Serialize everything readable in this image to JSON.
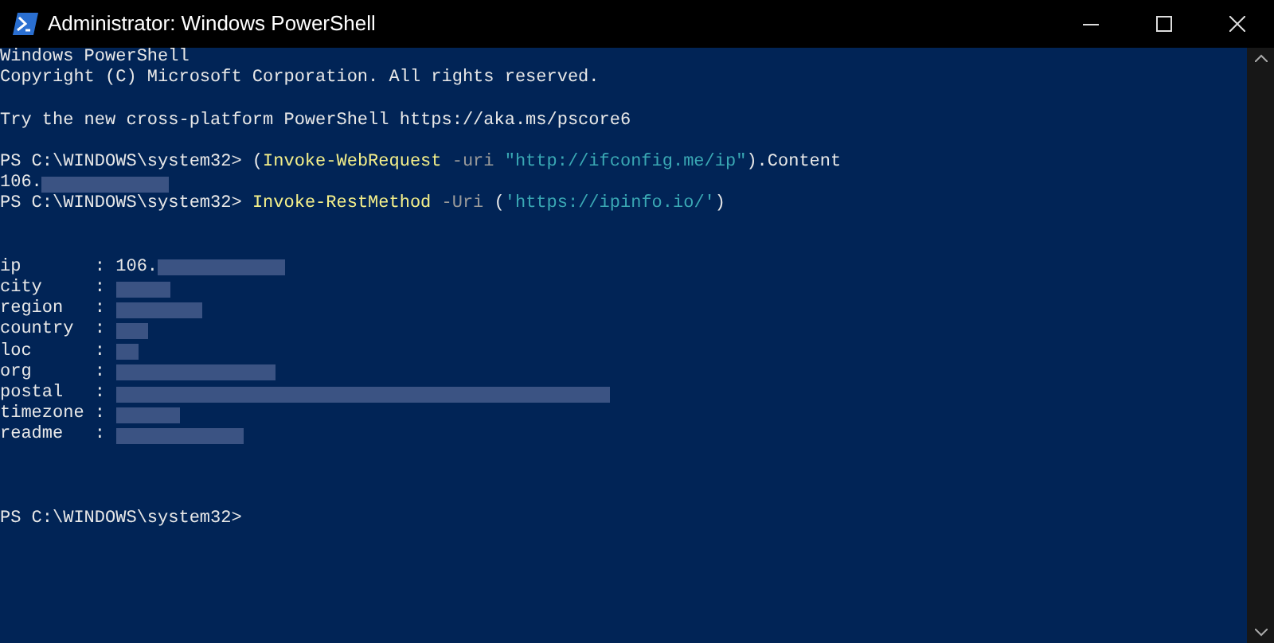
{
  "window": {
    "title": "Administrator: Windows PowerShell"
  },
  "console": {
    "lines": [
      {
        "kind": "text",
        "segments": [
          {
            "kind": "plain",
            "text": "Windows PowerShell"
          }
        ]
      },
      {
        "kind": "text",
        "segments": [
          {
            "kind": "plain",
            "text": "Copyright (C) Microsoft Corporation. All rights reserved."
          }
        ]
      },
      {
        "kind": "blank"
      },
      {
        "kind": "text",
        "segments": [
          {
            "kind": "plain",
            "text": "Try the new cross-platform PowerShell https://aka.ms/pscore6"
          }
        ]
      },
      {
        "kind": "blank"
      },
      {
        "kind": "text",
        "segments": [
          {
            "kind": "plain",
            "text": "PS C:\\WINDOWS\\system32> ("
          },
          {
            "kind": "command",
            "text": "Invoke-WebRequest"
          },
          {
            "kind": "parameter",
            "text": " -uri "
          },
          {
            "kind": "string",
            "text": "\"http://ifconfig.me/ip\""
          },
          {
            "kind": "plain",
            "text": ").Content"
          }
        ]
      },
      {
        "kind": "text",
        "segments": [
          {
            "kind": "plain",
            "text": "106."
          },
          {
            "kind": "redacted"
          }
        ]
      },
      {
        "kind": "text",
        "segments": [
          {
            "kind": "plain",
            "text": "PS C:\\WINDOWS\\system32> "
          },
          {
            "kind": "command",
            "text": "Invoke-RestMethod"
          },
          {
            "kind": "parameter",
            "text": " -Uri "
          },
          {
            "kind": "plain",
            "text": "("
          },
          {
            "kind": "string",
            "text": "'https://ipinfo.io/'"
          },
          {
            "kind": "plain",
            "text": ")"
          }
        ]
      },
      {
        "kind": "blank"
      },
      {
        "kind": "blank"
      },
      {
        "kind": "text",
        "segments": [
          {
            "kind": "plain",
            "text": "ip       : 106."
          },
          {
            "kind": "redacted"
          }
        ]
      },
      {
        "kind": "text",
        "segments": [
          {
            "kind": "plain",
            "text": "city     : "
          },
          {
            "kind": "redacted"
          }
        ]
      },
      {
        "kind": "text",
        "segments": [
          {
            "kind": "plain",
            "text": "region   : "
          },
          {
            "kind": "redacted"
          }
        ]
      },
      {
        "kind": "text",
        "segments": [
          {
            "kind": "plain",
            "text": "country  : "
          },
          {
            "kind": "redacted"
          }
        ]
      },
      {
        "kind": "text",
        "segments": [
          {
            "kind": "plain",
            "text": "loc      : "
          },
          {
            "kind": "redacted"
          }
        ]
      },
      {
        "kind": "text",
        "segments": [
          {
            "kind": "plain",
            "text": "org      : "
          },
          {
            "kind": "redacted"
          }
        ]
      },
      {
        "kind": "text",
        "segments": [
          {
            "kind": "plain",
            "text": "postal   : "
          },
          {
            "kind": "redacted"
          }
        ]
      },
      {
        "kind": "text",
        "segments": [
          {
            "kind": "plain",
            "text": "timezone : "
          },
          {
            "kind": "redacted"
          }
        ]
      },
      {
        "kind": "text",
        "segments": [
          {
            "kind": "plain",
            "text": "readme   : "
          },
          {
            "kind": "redacted"
          }
        ]
      },
      {
        "kind": "blank"
      },
      {
        "kind": "blank"
      },
      {
        "kind": "blank"
      },
      {
        "kind": "text",
        "segments": [
          {
            "kind": "plain",
            "text": "PS C:\\WINDOWS\\system32>"
          }
        ]
      }
    ]
  }
}
